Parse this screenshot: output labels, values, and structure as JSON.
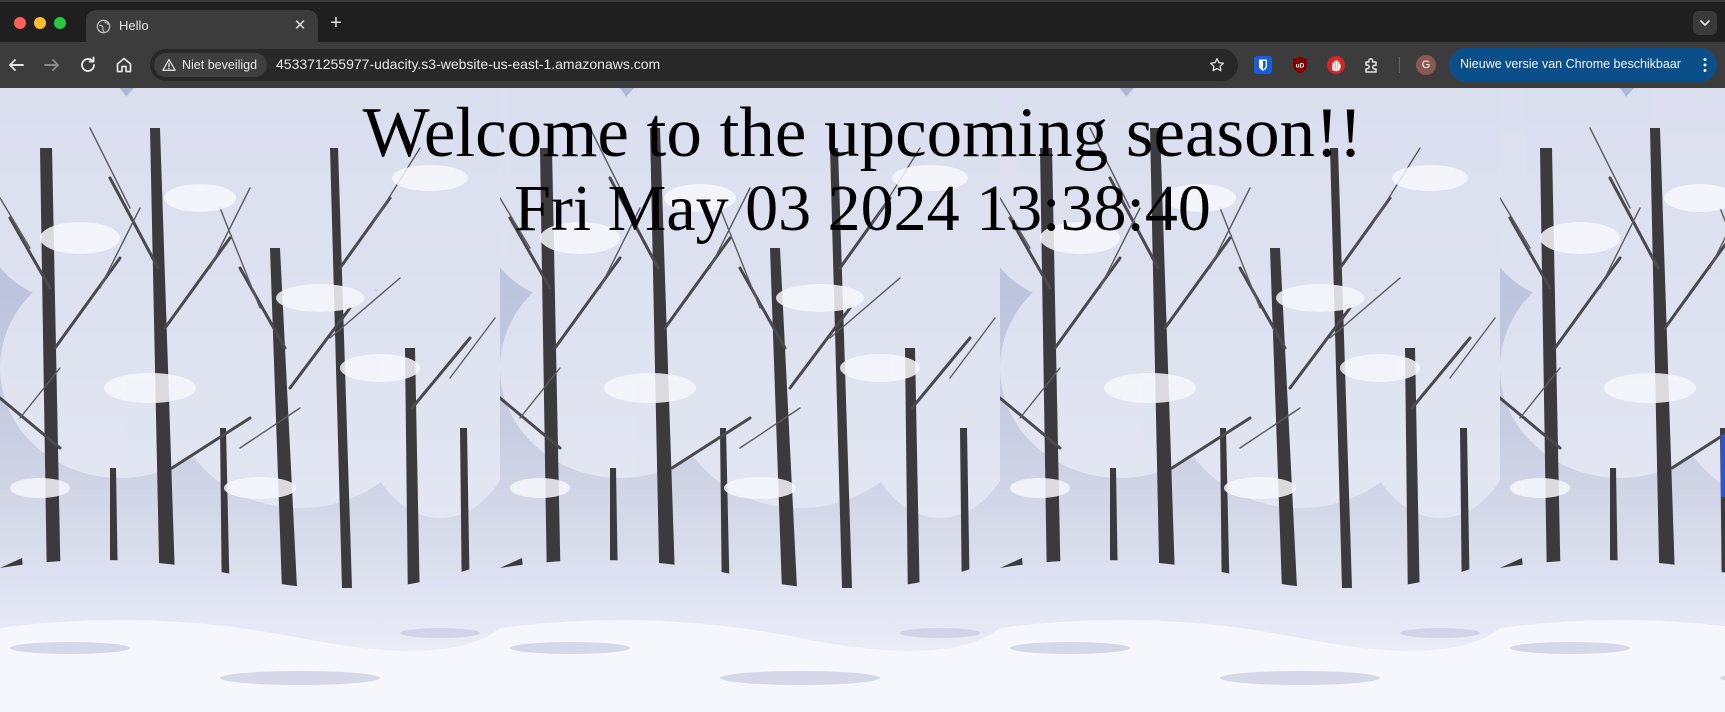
{
  "window": {
    "tab_title": "Hello",
    "tab_icon": "globe-icon"
  },
  "toolbar": {
    "security_label": "Niet beveiligd",
    "url": "453371255977-udacity.s3-website-us-east-1.amazonaws.com",
    "profile_initial": "G",
    "update_label": "Nieuwe versie van Chrome beschikbaar",
    "extensions": [
      "bitwarden-icon",
      "ublock-icon",
      "stop-hand-icon",
      "puzzle-extensions-icon"
    ]
  },
  "page": {
    "heading": "Welcome to the upcoming season!!",
    "datetime": "Fri May 03 2024 13:38:40",
    "background": "snowy-forest-image"
  },
  "colors": {
    "chrome_dark": "#1f1f1f",
    "toolbar": "#3c3c3c",
    "update_pill": "#0b4f8a",
    "snow_sky": "#c9cfe0"
  }
}
